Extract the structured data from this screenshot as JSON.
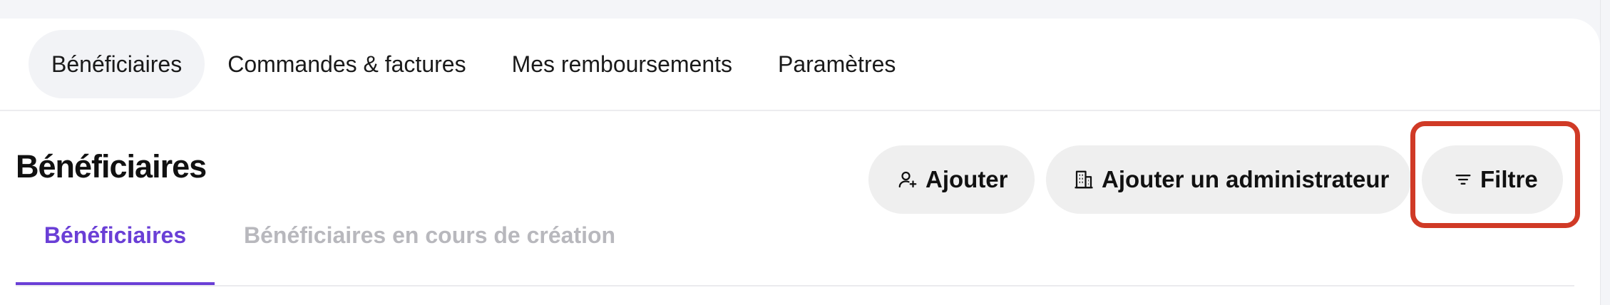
{
  "nav": {
    "items": [
      {
        "label": "Bénéficiaires",
        "active": true
      },
      {
        "label": "Commandes & factures",
        "active": false
      },
      {
        "label": "Mes remboursements",
        "active": false
      },
      {
        "label": "Paramètres",
        "active": false
      }
    ]
  },
  "header": {
    "title": "Bénéficiaires"
  },
  "actions": {
    "add": {
      "label": "Ajouter",
      "icon": "user-plus-icon"
    },
    "add_admin": {
      "label": "Ajouter un administrateur",
      "icon": "building-icon"
    },
    "filter": {
      "label": "Filtre",
      "icon": "filter-icon"
    }
  },
  "tabs": [
    {
      "label": "Bénéficiaires",
      "active": true
    },
    {
      "label": "Bénéficiaires en cours de création",
      "active": false
    }
  ],
  "colors": {
    "accent": "#6a3fd6",
    "highlight": "#d03a26",
    "button_bg": "#efefef"
  }
}
